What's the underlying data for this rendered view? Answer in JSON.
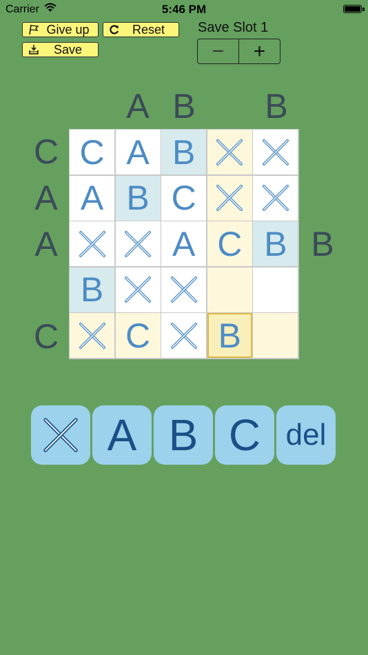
{
  "status_bar": {
    "carrier": "Carrier",
    "time": "5:46 PM"
  },
  "toolbar": {
    "give_up_label": "Give up",
    "reset_label": "Reset",
    "save_label": "Save",
    "slot_label": "Save Slot 1",
    "minus_label": "−",
    "plus_label": "+"
  },
  "clues": {
    "top": [
      "",
      "A",
      "B",
      "",
      "B"
    ],
    "left": [
      "C",
      "A",
      "A",
      "",
      "C"
    ],
    "right": [
      "",
      "",
      "B",
      "",
      ""
    ]
  },
  "grid": [
    [
      {
        "v": "C",
        "bg": "white"
      },
      {
        "v": "A",
        "bg": "white"
      },
      {
        "v": "B",
        "bg": "blue"
      },
      {
        "v": "X",
        "bg": "yellow"
      },
      {
        "v": "X",
        "bg": "white"
      }
    ],
    [
      {
        "v": "A",
        "bg": "white"
      },
      {
        "v": "B",
        "bg": "blue"
      },
      {
        "v": "C",
        "bg": "white"
      },
      {
        "v": "X",
        "bg": "yellow"
      },
      {
        "v": "X",
        "bg": "white"
      }
    ],
    [
      {
        "v": "X",
        "bg": "white"
      },
      {
        "v": "X",
        "bg": "white"
      },
      {
        "v": "A",
        "bg": "white"
      },
      {
        "v": "C",
        "bg": "yellow"
      },
      {
        "v": "B",
        "bg": "blue"
      }
    ],
    [
      {
        "v": "B",
        "bg": "blue"
      },
      {
        "v": "X",
        "bg": "white"
      },
      {
        "v": "X",
        "bg": "white"
      },
      {
        "v": "",
        "bg": "yellow"
      },
      {
        "v": "",
        "bg": "white"
      }
    ],
    [
      {
        "v": "X",
        "bg": "yellow"
      },
      {
        "v": "C",
        "bg": "yellow"
      },
      {
        "v": "X",
        "bg": "white"
      },
      {
        "v": "B",
        "bg": "selected"
      },
      {
        "v": "",
        "bg": "yellow"
      }
    ]
  ],
  "keypad": [
    "X",
    "A",
    "B",
    "C",
    "del"
  ]
}
